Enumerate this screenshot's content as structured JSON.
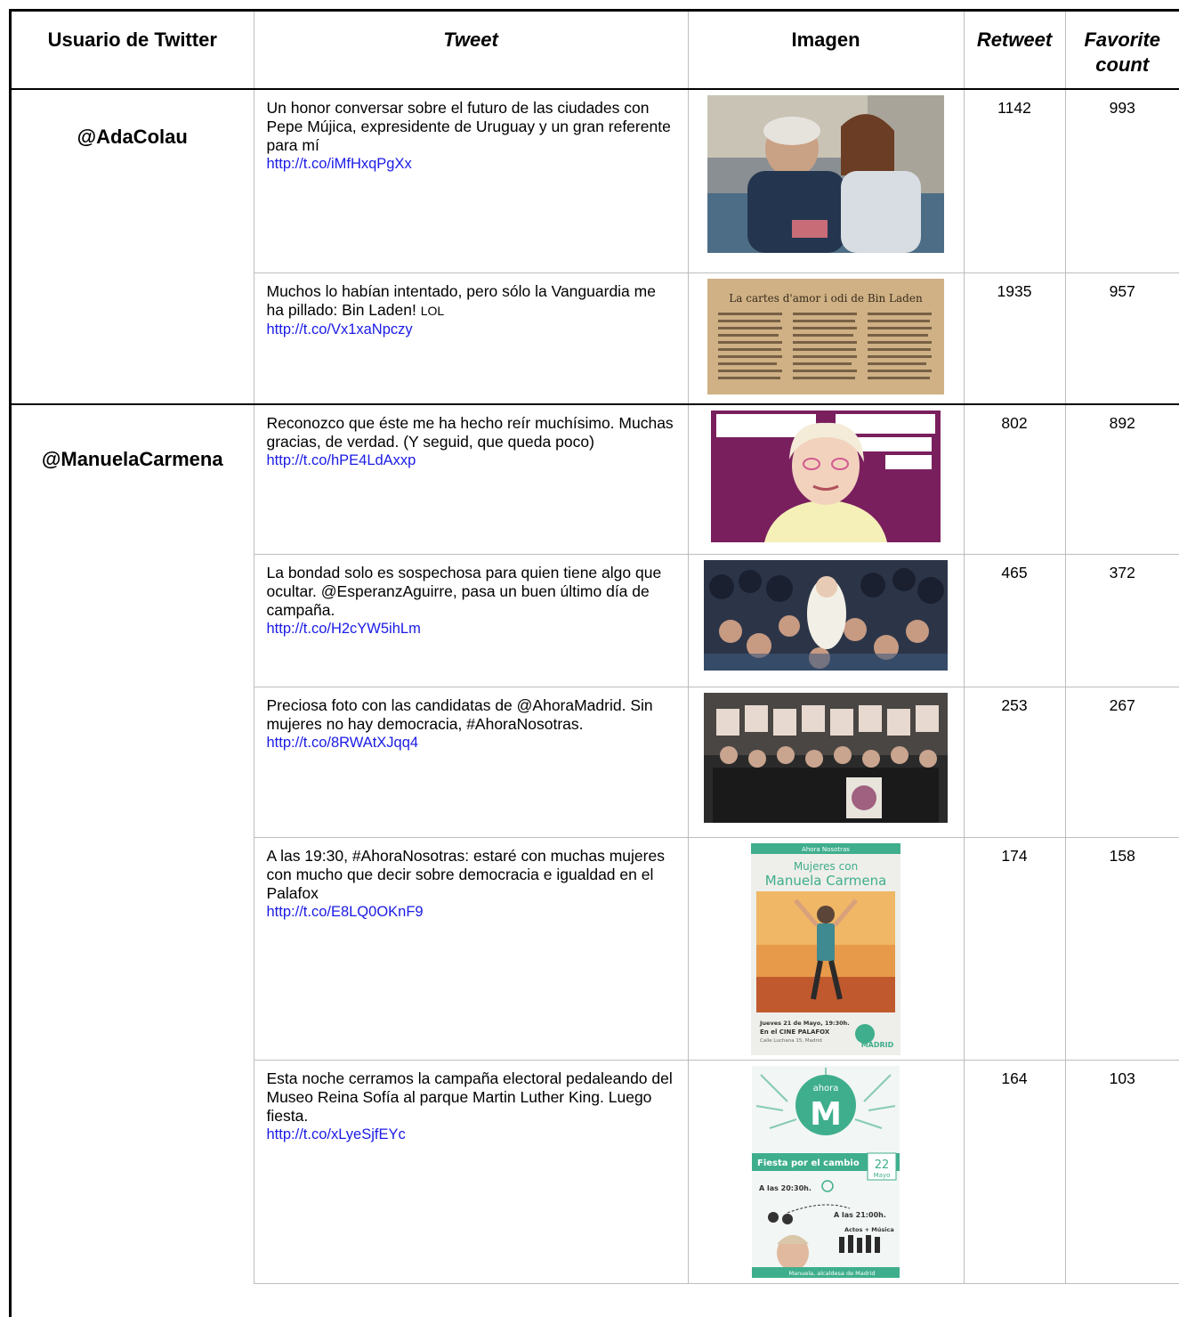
{
  "headers": {
    "user": "Usuario de Twitter",
    "tweet": "Tweet",
    "image": "Imagen",
    "retweet": "Retweet",
    "favorite_line1": "Favorite",
    "favorite_line2": "count"
  },
  "users": [
    "@AdaColau",
    "@ManuelaCarmena"
  ],
  "rows": [
    {
      "text": "Un honor conversar sobre el futuro de las ciudades con Pepe Mújica, expresidente de Uruguay y un gran referente para mí",
      "link": "http://t.co/iMfHxqPgXx",
      "retweet": "1142",
      "favorite": "993"
    },
    {
      "text": "Muchos lo habían intentado, pero sólo la Vanguardia me ha pillado: Bin Laden!",
      "text_small": "LOL",
      "link": "http://t.co/Vx1xaNpczy",
      "retweet": "1935",
      "favorite": "957",
      "image_title": "La cartes d'amor i odi de Bin Laden"
    },
    {
      "text": "Reconozco que éste me ha hecho reír muchísimo. Muchas gracias, de verdad. (Y seguid, que queda poco)",
      "link": "http://t.co/hPE4LdAxxp",
      "retweet": "802",
      "favorite": "892"
    },
    {
      "text": "La bondad solo es sospechosa para quien tiene algo que ocultar. @EsperanzAguirre, pasa un buen último día de campaña.",
      "link": "http://t.co/H2cYW5ihLm",
      "retweet": "465",
      "favorite": "372"
    },
    {
      "text": "Preciosa foto con las candidatas de @AhoraMadrid. Sin mujeres no hay democracia, #AhoraNosotras.",
      "link": "http://t.co/8RWAtXJqq4",
      "retweet": "253",
      "favorite": "267"
    },
    {
      "text": "A las 19:30, #AhoraNosotras: estaré con muchas mujeres con mucho que decir sobre democracia e igualdad en el Palafox",
      "link": "http://t.co/E8LQ0OKnF9",
      "retweet": "174",
      "favorite": "158",
      "poster": {
        "top": "Ahora Nosotras",
        "line1": "Mujeres con",
        "line2": "Manuela Carmena",
        "date": "Jueves 21 de Mayo, 19:30h.",
        "venue": "En el CINE PALAFOX",
        "address": "Calle Luchana 15, Madrid",
        "logo": "MADRID"
      }
    },
    {
      "text": "Esta noche cerramos la campaña electoral pedaleando del Museo Reina Sofía al parque Martin Luther King. Luego fiesta.",
      "link": "http://t.co/xLyeSjfEYc",
      "retweet": "164",
      "favorite": "103",
      "poster": {
        "ahora": "ahora",
        "m": "M",
        "banner": "Fiesta por el cambio",
        "day": "22",
        "month": "Mayo",
        "time1": "A las 20:30h.",
        "time2": "A las 21:00h.",
        "acts": "Actos + Música",
        "footer": "Manuela, alcaldesa de Madrid"
      }
    }
  ],
  "colors": {
    "link": "#1a1ae6",
    "purple_bg": "#7a1f5e",
    "green": "#3fae8c"
  }
}
